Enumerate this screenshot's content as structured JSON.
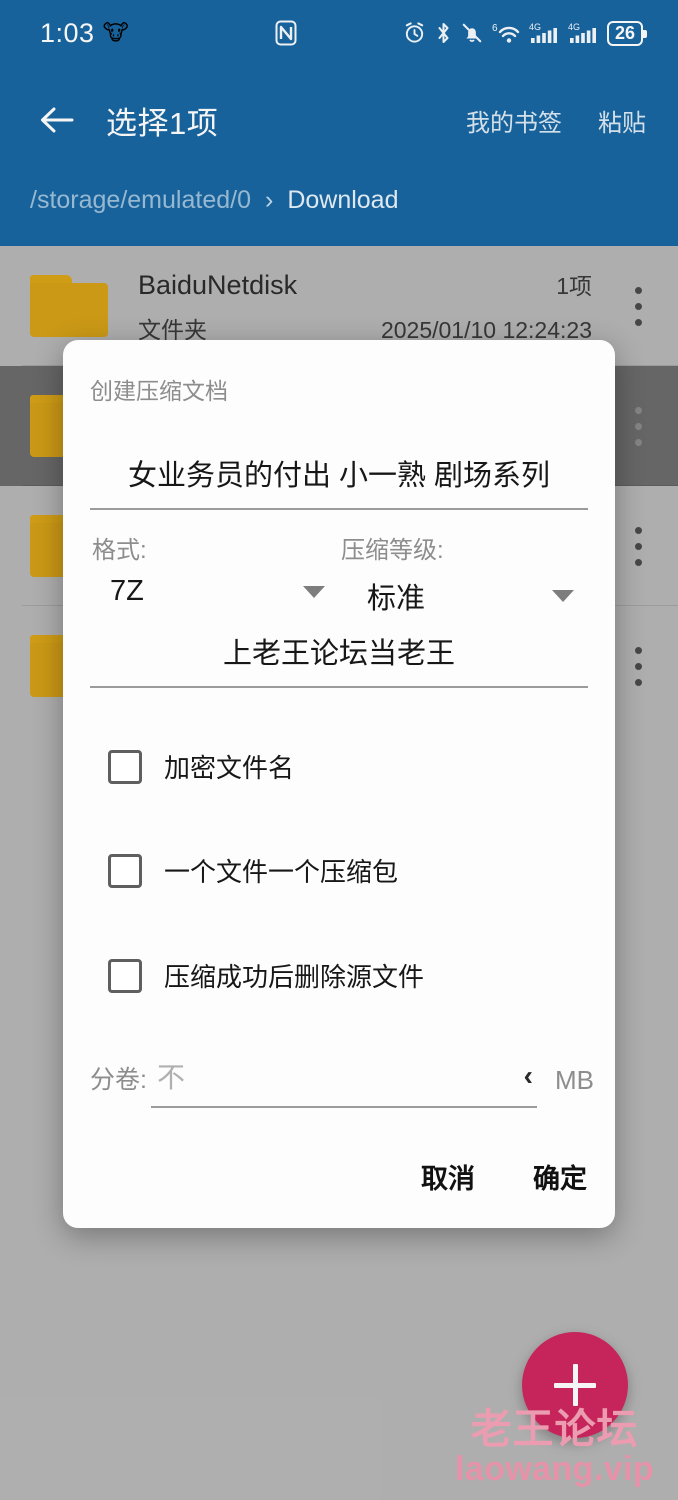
{
  "status_bar": {
    "time": "1:03",
    "emoji": "🐮",
    "nfc_icon": "nfc-icon",
    "icons": [
      "alarm-icon",
      "bluetooth-icon",
      "bell-off-icon",
      "wifi-6-icon",
      "signal-4g-icon",
      "signal-4g-icon-2"
    ],
    "wifi_superscript": "6",
    "network_label": "4G",
    "battery_level": "26",
    "background_color": "#1a67a3"
  },
  "app_bar": {
    "back_icon": "arrow-left-icon",
    "title": "选择1项",
    "actions": [
      {
        "label": "我的书签",
        "name": "my-bookmarks-button"
      },
      {
        "label": "粘贴",
        "name": "paste-button"
      }
    ],
    "breadcrumb": {
      "path": "/storage/emulated/0",
      "separator": "›",
      "leaf": "Download"
    }
  },
  "file_list": {
    "rows": [
      {
        "name": "BaiduNetdisk",
        "subtitle": "文件夹",
        "count": "1项",
        "date": "2025/01/10 12:24:23",
        "selected": false
      },
      {
        "name": "",
        "subtitle": "",
        "count": "",
        "date": "",
        "selected": true
      },
      {
        "name": "",
        "subtitle": "",
        "count": "",
        "date": "",
        "selected": false
      },
      {
        "name": "",
        "subtitle": "",
        "count": "",
        "date": "",
        "selected": false
      }
    ]
  },
  "fab": {
    "icon": "plus-icon",
    "color": "#cf275f"
  },
  "watermark": {
    "line1": "老王论坛",
    "line2": "laowang.vip",
    "color": "#f5a3b8"
  },
  "dialog": {
    "title": "创建压缩文档",
    "archive_name": {
      "value": "女业务员的付出 小一熟 剧场系列",
      "placeholder": ""
    },
    "format": {
      "label": "格式:",
      "value": "7Z",
      "caret_icon": "chevron-down-icon"
    },
    "level": {
      "label": "压缩等级:",
      "value": "标准",
      "caret_icon": "chevron-down-icon"
    },
    "password": {
      "value": "上老王论坛当老王",
      "placeholder": ""
    },
    "checkboxes": [
      {
        "label": "加密文件名",
        "checked": false,
        "name": "encrypt-filenames-checkbox"
      },
      {
        "label": "一个文件一个压缩包",
        "checked": false,
        "name": "one-archive-per-file-checkbox"
      },
      {
        "label": "压缩成功后删除源文件",
        "checked": false,
        "name": "delete-source-after-checkbox"
      }
    ],
    "split": {
      "label": "分卷:",
      "placeholder": "不",
      "value": "",
      "chevron_icon": "chevron-left-icon",
      "unit": "MB"
    },
    "buttons": {
      "cancel": "取消",
      "confirm": "确定"
    }
  }
}
